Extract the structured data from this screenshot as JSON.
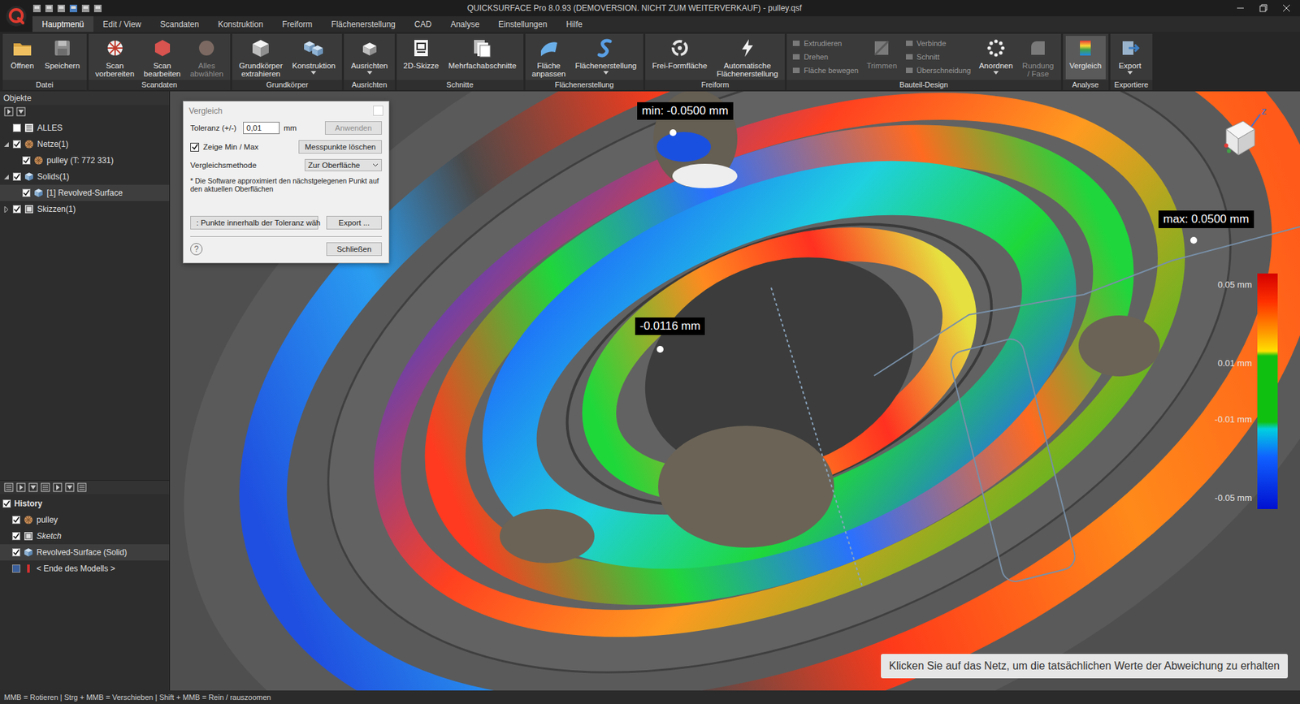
{
  "window": {
    "title": "QUICKSURFACE Pro 8.0.93 (DEMOVERSION. NICHT ZUM WEITERVERKAUF) - pulley.qsf"
  },
  "menu_tabs": [
    {
      "label": "Hauptmenü",
      "selected": true
    },
    {
      "label": "Edit / View",
      "selected": false
    },
    {
      "label": "Scandaten",
      "selected": false
    },
    {
      "label": "Konstruktion",
      "selected": false
    },
    {
      "label": "Freiform",
      "selected": false
    },
    {
      "label": "Flächenerstellung",
      "selected": false
    },
    {
      "label": "CAD",
      "selected": false
    },
    {
      "label": "Analyse",
      "selected": false
    },
    {
      "label": "Einstellungen",
      "selected": false
    },
    {
      "label": "Hilfe",
      "selected": false
    }
  ],
  "ribbon": {
    "groups": [
      {
        "label": "Datei",
        "items": [
          {
            "kind": "large",
            "label": "Öffnen",
            "disabled": false,
            "selected": false,
            "dropdown": false
          },
          {
            "kind": "large",
            "label": "Speichern",
            "disabled": false,
            "selected": false,
            "dropdown": false
          }
        ]
      },
      {
        "label": "Scandaten",
        "items": [
          {
            "kind": "large",
            "label": "Scan\nvorbereiten",
            "disabled": false,
            "selected": false,
            "dropdown": false
          },
          {
            "kind": "large",
            "label": "Scan\nbearbeiten",
            "disabled": false,
            "selected": false,
            "dropdown": false
          },
          {
            "kind": "large",
            "label": "Alles\nabwählen",
            "disabled": true,
            "selected": false,
            "dropdown": false
          }
        ]
      },
      {
        "label": "Grundkörper",
        "items": [
          {
            "kind": "large",
            "label": "Grundkörper\nextrahieren",
            "disabled": false,
            "selected": false,
            "dropdown": false
          },
          {
            "kind": "large",
            "label": "Konstruktion",
            "disabled": false,
            "selected": false,
            "dropdown": true
          }
        ]
      },
      {
        "label": "Ausrichten",
        "items": [
          {
            "kind": "large",
            "label": "Ausrichten",
            "disabled": false,
            "selected": false,
            "dropdown": true
          }
        ]
      },
      {
        "label": "Schnitte",
        "items": [
          {
            "kind": "large",
            "label": "2D-Skizze",
            "disabled": false,
            "selected": false,
            "dropdown": false
          },
          {
            "kind": "large",
            "label": "Mehrfachabschnitte",
            "disabled": false,
            "selected": false,
            "dropdown": false
          }
        ]
      },
      {
        "label": "Flächenerstellung",
        "items": [
          {
            "kind": "large",
            "label": "Fläche\nanpassen",
            "disabled": false,
            "selected": false,
            "dropdown": false
          },
          {
            "kind": "large",
            "label": "Flächenerstellung",
            "disabled": false,
            "selected": false,
            "dropdown": true
          }
        ]
      },
      {
        "label": "Freiform",
        "items": [
          {
            "kind": "large",
            "label": "Frei-Formfläche",
            "disabled": false,
            "selected": false,
            "dropdown": false
          },
          {
            "kind": "large",
            "label": "Automatische\nFlächenerstellung",
            "disabled": false,
            "selected": false,
            "dropdown": false
          }
        ]
      },
      {
        "label": "Bauteil-Design",
        "items": [
          {
            "kind": "stack",
            "items": [
              {
                "label": "Extrudieren",
                "disabled": true
              },
              {
                "label": "Drehen",
                "disabled": true
              },
              {
                "label": "Fläche bewegen",
                "disabled": true
              }
            ]
          },
          {
            "kind": "large",
            "label": "Trimmen",
            "disabled": true,
            "selected": false,
            "dropdown": false
          },
          {
            "kind": "stack",
            "items": [
              {
                "label": "Verbinde",
                "disabled": true
              },
              {
                "label": "Schnitt",
                "disabled": true
              },
              {
                "label": "Überschneidung",
                "disabled": true
              }
            ]
          },
          {
            "kind": "large",
            "label": "Anordnen",
            "disabled": false,
            "selected": false,
            "dropdown": true
          },
          {
            "kind": "large",
            "label": "Rundung\n/ Fase",
            "disabled": true,
            "selected": false,
            "dropdown": false
          }
        ]
      },
      {
        "label": "Analyse",
        "items": [
          {
            "kind": "large",
            "label": "Vergleich",
            "disabled": false,
            "selected": true,
            "dropdown": false
          }
        ]
      },
      {
        "label": "Exportiere",
        "items": [
          {
            "kind": "large",
            "label": "Export",
            "disabled": false,
            "selected": false,
            "dropdown": true
          }
        ]
      }
    ]
  },
  "objects_panel": {
    "title": "Objekte",
    "items": [
      {
        "label": "ALLES",
        "kind": "all",
        "level": 0,
        "expandable": false,
        "expanded": false,
        "checked": false,
        "selected": false,
        "italic": false
      },
      {
        "label": "Netze(1)",
        "kind": "mesh",
        "level": 0,
        "expandable": true,
        "expanded": true,
        "checked": true,
        "selected": false,
        "italic": false
      },
      {
        "label": "pulley (T: 772 331)",
        "kind": "mesh",
        "level": 1,
        "expandable": false,
        "expanded": false,
        "checked": true,
        "selected": false,
        "italic": false
      },
      {
        "label": "Solids(1)",
        "kind": "solid",
        "level": 0,
        "expandable": true,
        "expanded": true,
        "checked": true,
        "selected": false,
        "italic": false
      },
      {
        "label": "[1] Revolved-Surface",
        "kind": "solid",
        "level": 1,
        "expandable": false,
        "expanded": false,
        "checked": true,
        "selected": true,
        "italic": false
      },
      {
        "label": "Skizzen(1)",
        "kind": "sketch",
        "level": 0,
        "expandable": true,
        "expanded": false,
        "checked": true,
        "selected": false,
        "italic": false
      }
    ]
  },
  "history_panel": {
    "items": [
      {
        "label": "History",
        "kind": "root",
        "level": 0,
        "checked": true,
        "selected": false,
        "italic": false
      },
      {
        "label": "pulley",
        "kind": "mesh",
        "level": 1,
        "checked": true,
        "selected": false,
        "italic": false
      },
      {
        "label": "Sketch",
        "kind": "sketch",
        "level": 1,
        "checked": true,
        "selected": false,
        "italic": true
      },
      {
        "label": "Revolved-Surface (Solid)",
        "kind": "solid",
        "level": 1,
        "checked": true,
        "selected": true,
        "italic": false
      },
      {
        "label": "< Ende des Modells >",
        "kind": "end",
        "level": 1,
        "checked": false,
        "selected": false,
        "italic": false
      }
    ]
  },
  "dialog": {
    "title": "Vergleich",
    "tolerance_label": "Toleranz (+/-)",
    "tolerance_value": "0,01",
    "tolerance_unit": "mm",
    "apply": {
      "label": "Anwenden",
      "disabled": true
    },
    "show_minmax": {
      "label": "Zeige Min / Max",
      "checked": true
    },
    "clear_button": "Messpunkte löschen",
    "method_label": "Vergleichsmethode",
    "method_value": "Zur Oberfläche",
    "note": "* Die Software approximiert den nächstgelegenen Punkt auf den aktuellen Oberflächen",
    "select_button": ": Punkte innerhalb der Toleranz wäh",
    "export_button": "Export ...",
    "help": "?",
    "close_button": "Schließen"
  },
  "measurements": [
    {
      "label": "min: -0.0500 mm"
    },
    {
      "label": "max: 0.0500 mm"
    },
    {
      "label": "-0.0116 mm"
    }
  ],
  "legend": {
    "ticks": [
      "0.05 mm",
      "0.01 mm",
      "-0.01 mm",
      "-0.05 mm"
    ]
  },
  "nav_cube": {
    "axis": "z"
  },
  "hint": "Klicken Sie auf das Netz, um die tatsächlichen Werte der Abweichung zu erhalten",
  "status_bar": "MMB = Rotieren | Strg + MMB = Verschieben | Shift + MMB = Rein / rauszoomen"
}
